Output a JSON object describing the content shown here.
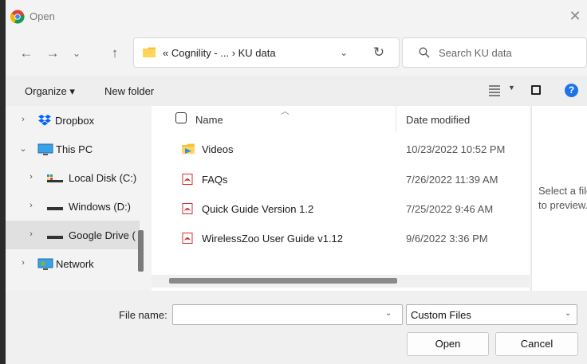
{
  "window": {
    "title": "Open",
    "close_glyph": "✕"
  },
  "address": {
    "path_text": "«  Cognility - ...  ›  KU data",
    "icons": [
      "back-icon",
      "forward-icon",
      "recent-locations-icon",
      "up-icon",
      "folder-icon",
      "chevron-down-icon",
      "refresh-icon"
    ]
  },
  "search": {
    "placeholder": "Search KU data"
  },
  "toolbar": {
    "organize": "Organize ▾",
    "new_folder": "New folder"
  },
  "nav": {
    "items": [
      {
        "label": "Dropbox",
        "icon": "dropbox-icon",
        "expander": "›"
      },
      {
        "label": "This PC",
        "icon": "pc-icon",
        "expander": "⌄"
      },
      {
        "label": "Local Disk (C:)",
        "icon": "drive-icon",
        "expander": "›"
      },
      {
        "label": "Windows (D:)",
        "icon": "drive-icon",
        "expander": "›"
      },
      {
        "label": "Google Drive (",
        "icon": "drive-icon",
        "expander": "›"
      },
      {
        "label": "Network",
        "icon": "network-icon",
        "expander": "›"
      }
    ]
  },
  "files": {
    "columns": {
      "name": "Name",
      "date": "Date modified"
    },
    "rows": [
      {
        "name": "Videos",
        "date": "10/23/2022 10:52 PM",
        "icon": "folder-icon"
      },
      {
        "name": "FAQs",
        "date": "7/26/2022 11:39 AM",
        "icon": "pdf-icon"
      },
      {
        "name": "Quick Guide Version 1.2",
        "date": "7/25/2022 9:46 AM",
        "icon": "pdf-icon"
      },
      {
        "name": "WirelessZoo User Guide v1.12",
        "date": "9/6/2022 3:36 PM",
        "icon": "pdf-icon"
      }
    ]
  },
  "preview": {
    "line1": "Select a file",
    "line2": "to preview."
  },
  "bottom": {
    "filename_label": "File name:",
    "filename_value": "",
    "filetype": "Custom Files",
    "open": "Open",
    "cancel": "Cancel"
  },
  "colors": {
    "accent": "#1a73e8",
    "folder": "#f5c33b",
    "pdf": "#d32f2f"
  }
}
